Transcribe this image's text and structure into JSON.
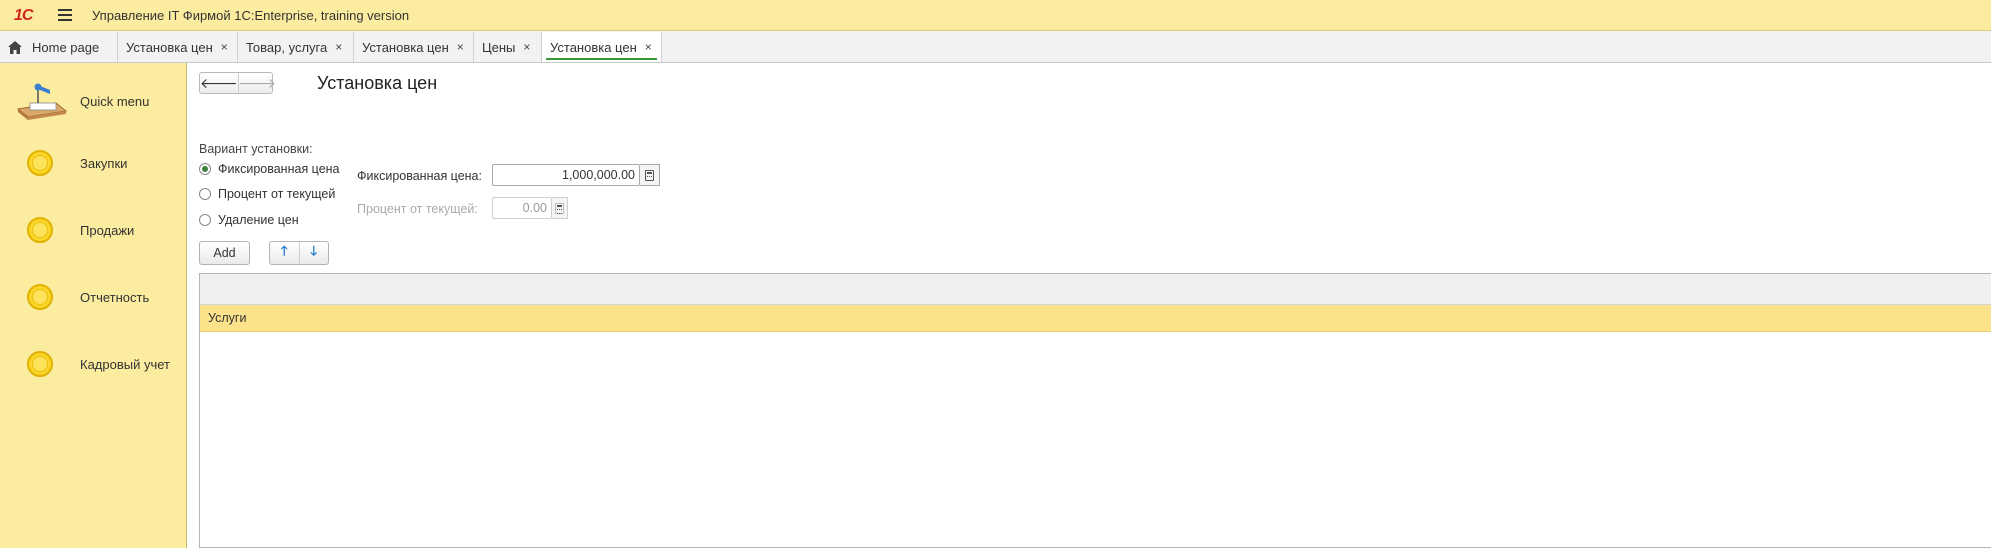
{
  "app": {
    "logo": "1С",
    "title": "Управление IT Фирмой 1С:Enterprise, training version"
  },
  "tabs": [
    {
      "label": "Home page",
      "closable": false
    },
    {
      "label": "Установка цен",
      "closable": true
    },
    {
      "label": "Товар, услуга",
      "closable": true
    },
    {
      "label": "Установка цен",
      "closable": true
    },
    {
      "label": "Цены",
      "closable": true
    },
    {
      "label": "Установка цен",
      "closable": true,
      "active": true
    }
  ],
  "close_glyph": "×",
  "sidebar": {
    "items": [
      {
        "label": "Quick menu",
        "icon": "quick-menu-icon"
      },
      {
        "label": "Закупки",
        "icon": "section-circle-icon"
      },
      {
        "label": "Продажи",
        "icon": "section-circle-icon"
      },
      {
        "label": "Отчетность",
        "icon": "section-circle-icon"
      },
      {
        "label": "Кадровый учет",
        "icon": "section-circle-icon"
      }
    ]
  },
  "form": {
    "title": "Установка цен",
    "nav": {
      "back": "🡐",
      "forward": "🡒"
    },
    "variant_label": "Вариант установки:",
    "variants": [
      {
        "label": "Фиксированная цена",
        "selected": true
      },
      {
        "label": "Процент от текущей",
        "selected": false
      },
      {
        "label": "Удаление цен",
        "selected": false
      }
    ],
    "fixed_price": {
      "label": "Фиксированная цена:",
      "value": "1,000,000.00"
    },
    "percent": {
      "label": "Процент от текущей:",
      "value": "0.00",
      "disabled": true
    },
    "add_button": "Add",
    "move_up": "🡑",
    "move_down": "🡓"
  },
  "table": {
    "rows": [
      {
        "label": "Услуги"
      }
    ]
  },
  "colors": {
    "panel_yellow": "#fbeca0",
    "selected_row": "#fce28b",
    "active_tab_underline": "#3a9a3a"
  }
}
